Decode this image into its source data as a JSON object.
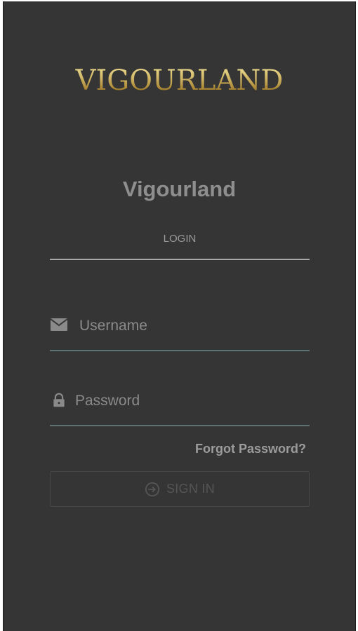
{
  "brand": {
    "logo_text": "VIGOURLAND",
    "app_title": "Vigourland"
  },
  "tabs": [
    {
      "label": "LOGIN",
      "active": true
    }
  ],
  "form": {
    "username": {
      "placeholder": "Username",
      "value": "",
      "icon": "envelope-icon"
    },
    "password": {
      "placeholder": "Password",
      "value": "",
      "icon": "lock-icon"
    },
    "forgot_label": "Forgot Password?",
    "signin": {
      "label": "SIGN IN",
      "icon": "sign-in-icon",
      "enabled": false
    }
  },
  "colors": {
    "background": "#353535",
    "logo_gold": "#c9ad5c",
    "field_underline": "#5f7470",
    "text_muted": "#8e8e8e"
  }
}
